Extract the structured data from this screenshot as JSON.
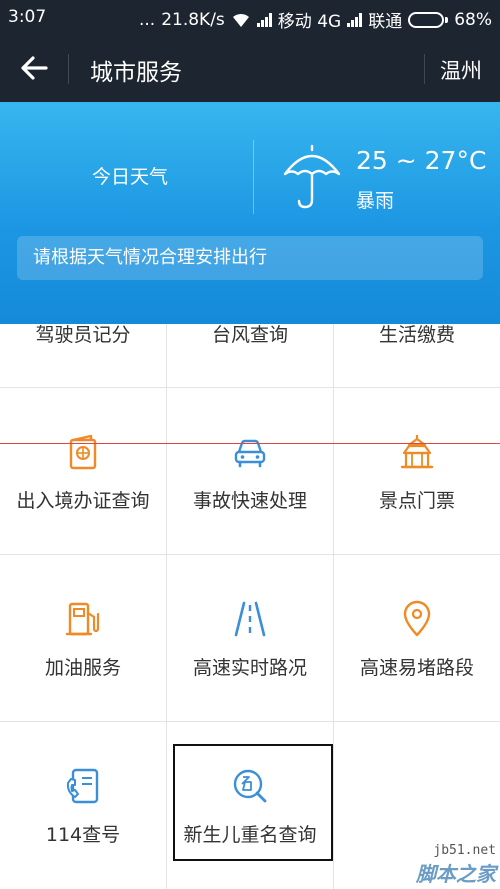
{
  "status_bar": {
    "time": "3:07",
    "dots": "...",
    "speed": "21.8K/s",
    "carrier1": "移动 4G",
    "carrier2": "联通",
    "battery": "68%",
    "battery_level": 0.68
  },
  "header": {
    "title": "城市服务",
    "city": "温州",
    "back_icon": "arrow-left-icon"
  },
  "weather": {
    "label": "今日天气",
    "temperature": "25 ~ 27°C",
    "condition": "暴雨",
    "tip": "请根据天气情况合理安排出行",
    "icon": "umbrella-icon"
  },
  "services": {
    "row1": [
      "驾驶员记分",
      "台风查询",
      "生活缴费"
    ],
    "row2": [
      "出入境办证查询",
      "事故快速处理",
      "景点门票"
    ],
    "row3": [
      "加油服务",
      "高速实时路况",
      "高速易堵路段"
    ],
    "row4": [
      "114查号",
      "新生儿重名查询"
    ]
  },
  "colors": {
    "header_bg": "#1d2530",
    "weather_blue": "#1d97e3",
    "icon_orange": "#f08a24",
    "icon_blue": "#3a8fd8"
  },
  "watermark": {
    "site": "jb51.net",
    "name": "脚本之家"
  }
}
